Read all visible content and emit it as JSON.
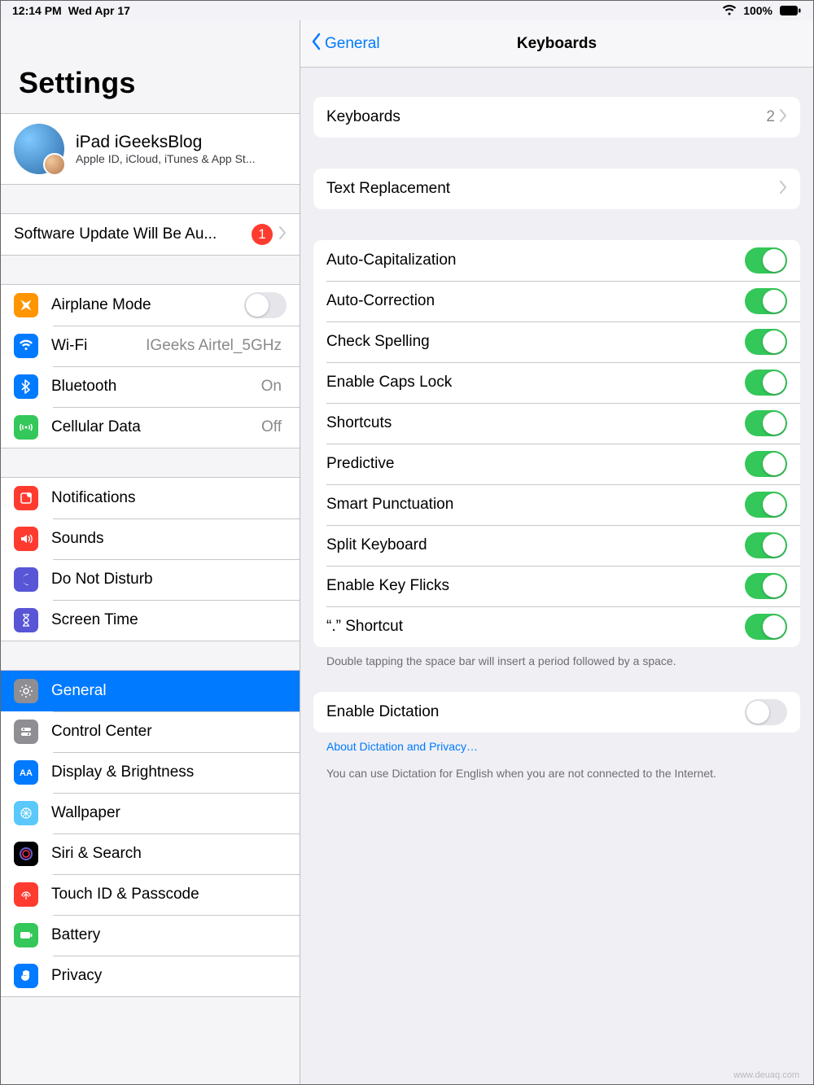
{
  "status": {
    "time": "12:14 PM",
    "date": "Wed Apr 17",
    "battery_pct": "100%"
  },
  "sidebar": {
    "title": "Settings",
    "apple_id": {
      "name": "iPad iGeeksBlog",
      "subtitle": "Apple ID, iCloud, iTunes & App St..."
    },
    "update": {
      "label": "Software Update Will Be Au...",
      "badge": "1"
    },
    "connectivity": {
      "airplane": "Airplane Mode",
      "wifi": "Wi-Fi",
      "wifi_value": "IGeeks Airtel_5GHz",
      "bluetooth": "Bluetooth",
      "bluetooth_value": "On",
      "cellular": "Cellular Data",
      "cellular_value": "Off"
    },
    "prefs1": {
      "notifications": "Notifications",
      "sounds": "Sounds",
      "dnd": "Do Not Disturb",
      "screentime": "Screen Time"
    },
    "prefs2": {
      "general": "General",
      "control": "Control Center",
      "display": "Display & Brightness",
      "wallpaper": "Wallpaper",
      "siri": "Siri & Search",
      "touchid": "Touch ID & Passcode",
      "battery": "Battery",
      "privacy": "Privacy"
    }
  },
  "detail": {
    "back": "General",
    "title": "Keyboards",
    "kb_row": "Keyboards",
    "kb_count": "2",
    "text_replace": "Text Replacement",
    "toggles": {
      "autocap": "Auto-Capitalization",
      "autocorrect": "Auto-Correction",
      "spell": "Check Spelling",
      "caps": "Enable Caps Lock",
      "shortcuts": "Shortcuts",
      "predictive": "Predictive",
      "smart": "Smart Punctuation",
      "split": "Split Keyboard",
      "flicks": "Enable Key Flicks",
      "period": "“.” Shortcut"
    },
    "toggles_footer": "Double tapping the space bar will insert a period followed by a space.",
    "dictation": "Enable Dictation",
    "dictation_link": "About Dictation and Privacy…",
    "dictation_footer": "You can use Dictation for English when you are not connected to the Internet."
  },
  "watermark": "www.deuaq.com"
}
